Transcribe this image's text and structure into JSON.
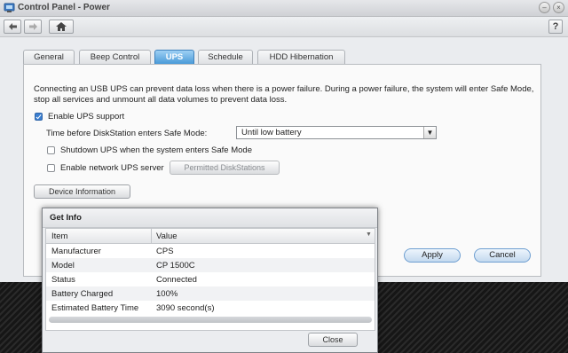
{
  "window": {
    "title": "Control Panel - Power",
    "help_label": "?"
  },
  "toolbar": {
    "back": "back-arrow",
    "forward": "forward-arrow",
    "home": "home"
  },
  "tabs": [
    {
      "label": "General"
    },
    {
      "label": "Beep Control"
    },
    {
      "label": "UPS"
    },
    {
      "label": "Schedule"
    },
    {
      "label": "HDD Hibernation"
    }
  ],
  "ups": {
    "description": "Connecting an USB UPS can prevent data loss when there is a power failure. During a power failure, the system will enter Safe Mode, stop all services and unmount all data volumes to prevent data loss.",
    "enable_label": "Enable UPS support",
    "enable_checked": true,
    "time_label": "Time before DiskStation enters Safe Mode:",
    "time_value": "Until low battery",
    "shutdown_label": "Shutdown UPS when the system enters Safe Mode",
    "shutdown_checked": false,
    "network_label": "Enable network UPS server",
    "network_checked": false,
    "permitted_label": "Permitted DiskStations",
    "device_info_label": "Device Information"
  },
  "actions": {
    "apply": "Apply",
    "cancel": "Cancel"
  },
  "dialog": {
    "title": "Get Info",
    "columns": [
      "Item",
      "Value"
    ],
    "rows": [
      [
        "Manufacturer",
        "CPS"
      ],
      [
        "Model",
        "CP 1500C"
      ],
      [
        "Status",
        "Connected"
      ],
      [
        "Battery Charged",
        "100%"
      ],
      [
        "Estimated Battery Time",
        "3090 second(s)"
      ]
    ],
    "close_label": "Close"
  },
  "colors": {
    "active_tab": "#4a9ad8",
    "checkbox_accent": "#3b7fd1",
    "pill_border": "#6e9fd1"
  }
}
